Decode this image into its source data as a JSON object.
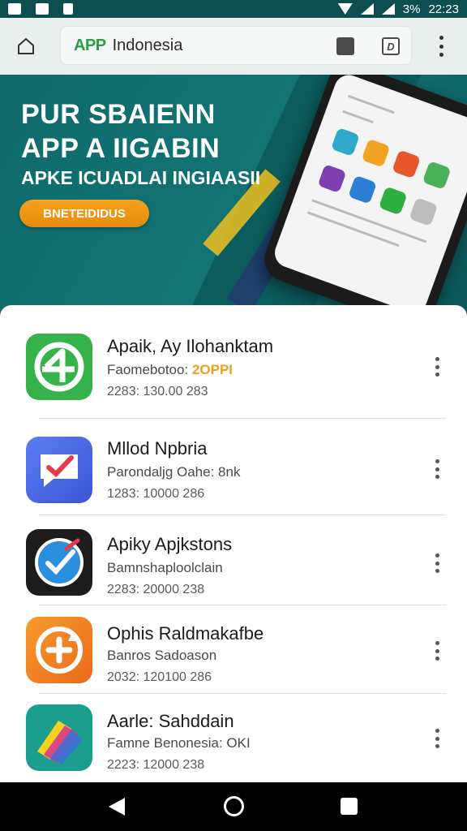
{
  "status_bar": {
    "battery": "3%",
    "time": "22:23"
  },
  "browser": {
    "url_brand": "APP",
    "url_text": "Indonesia",
    "url_tool_2": "D"
  },
  "hero": {
    "title_line1": "PUR SBAIENN",
    "title_line2": "APP  A  IIGABIN",
    "subtitle": "APKE ICUADLAI INGIAASII",
    "cta_label": "BNETEIDIDUS"
  },
  "apps": [
    {
      "title": "Apaik, Ay Ilohanktam",
      "subtitle": "Faomebotoo:",
      "subtitle_highlight": "2OPPI",
      "meta": "2283: 130.00  283",
      "icon": "ap-logo-icon"
    },
    {
      "title": "Mllod Npbria",
      "subtitle": "Parondaljg Oahe: 8nk",
      "subtitle_highlight": "",
      "meta": "1283: 10000  286",
      "icon": "chat-check-icon"
    },
    {
      "title": "Apiky Apjkstons",
      "subtitle": "Bamnshaploolclain",
      "subtitle_highlight": "",
      "meta": "2283: 20000  238",
      "icon": "check-circle-icon"
    },
    {
      "title": "Ophis Raldmakafbe",
      "subtitle": "Banros Sadoason",
      "subtitle_highlight": "",
      "meta": "2032: 120100  286",
      "icon": "plus-sync-icon"
    },
    {
      "title": "Aarle: Sahddain",
      "subtitle": "Famne Benonesia: OKI",
      "subtitle_highlight": "",
      "meta": "2223: 12000  238",
      "icon": "layers-icon"
    }
  ],
  "colors": {
    "accent_green": "#2e9c44",
    "accent_orange": "#f29a1c",
    "teal": "#127474"
  }
}
